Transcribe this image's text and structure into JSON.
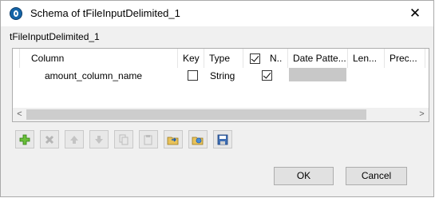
{
  "window": {
    "title": "Schema of tFileInputDelimited_1",
    "close_glyph": "✕"
  },
  "component_label": "tFileInputDelimited_1",
  "schema_table": {
    "columns": [
      "Column",
      "Key",
      "Type",
      "N..",
      "Date Patte...",
      "Len...",
      "Prec..."
    ],
    "header_checkbox_checked": true,
    "rows": [
      {
        "column": "amount_column_name",
        "key": false,
        "type": "String",
        "nullable": true,
        "date_pattern": ""
      }
    ]
  },
  "scroll": {
    "left_glyph": "<",
    "right_glyph": ">"
  },
  "toolbar": {
    "icons": [
      "add-icon",
      "remove-icon",
      "move-up-icon",
      "move-down-icon",
      "copy-icon",
      "paste-icon",
      "import-schema-icon",
      "export-schema-icon",
      "save-icon"
    ]
  },
  "buttons": {
    "ok": "OK",
    "cancel": "Cancel"
  }
}
